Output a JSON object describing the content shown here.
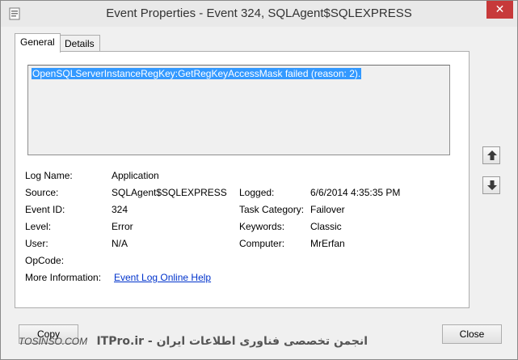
{
  "window": {
    "title": "Event Properties - Event 324, SQLAgent$SQLEXPRESS",
    "close_glyph": "✕"
  },
  "tabs": [
    {
      "label": "General",
      "selected": true
    },
    {
      "label": "Details",
      "selected": false
    }
  ],
  "description": "OpenSQLServerInstanceRegKey:GetRegKeyAccessMask failed (reason: 2).",
  "fields": {
    "log_name": {
      "label": "Log Name:",
      "value": "Application"
    },
    "source": {
      "label": "Source:",
      "value": "SQLAgent$SQLEXPRESS"
    },
    "logged": {
      "label": "Logged:",
      "value": "6/6/2014 4:35:35 PM"
    },
    "event_id": {
      "label": "Event ID:",
      "value": "324"
    },
    "task_category": {
      "label": "Task Category:",
      "value": "Failover"
    },
    "level": {
      "label": "Level:",
      "value": "Error"
    },
    "keywords": {
      "label": "Keywords:",
      "value": "Classic"
    },
    "user": {
      "label": "User:",
      "value": "N/A"
    },
    "computer": {
      "label": "Computer:",
      "value": "MrErfan"
    },
    "opcode": {
      "label": "OpCode:",
      "value": ""
    },
    "more_info": {
      "label": "More Information:",
      "link": "Event Log Online Help"
    }
  },
  "buttons": {
    "copy": "Copy",
    "close": "Close"
  },
  "watermark": {
    "left": "TOSINSO.COM",
    "right": "انجمن تخصصی فناوری اطلاعات ایران - ITPro.ir"
  },
  "icons": {
    "app": "event-viewer-icon",
    "up": "arrow-up-icon",
    "down": "arrow-down-icon"
  }
}
